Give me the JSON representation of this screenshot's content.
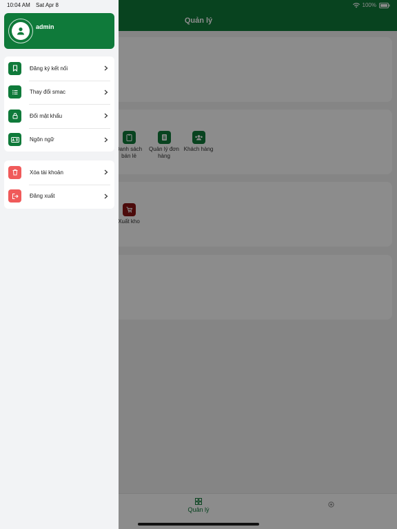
{
  "status_bar": {
    "time": "10:04 AM",
    "date": "Sat Apr 8",
    "battery": "100%"
  },
  "header": {
    "title": "Quản lý"
  },
  "tiles": {
    "retail_list": "Danh sách bán lẻ",
    "order_management": "Quản lý đơn hàng",
    "customers": "Khách hàng",
    "export_warehouse": "Xuất kho"
  },
  "tabbar": {
    "manage_label": "Quản lý"
  },
  "drawer": {
    "username": "admin",
    "menu": [
      {
        "label": "Đăng ký kết nối",
        "icon": "bookmark-icon"
      },
      {
        "label": "Thay đổi smac",
        "icon": "list-icon"
      },
      {
        "label": "Đổi mật khẩu",
        "icon": "lock-icon"
      },
      {
        "label": "Ngôn ngữ",
        "icon": "language-icon"
      }
    ],
    "account": [
      {
        "label": "Xóa tài khoản",
        "icon": "trash-icon"
      },
      {
        "label": "Đăng xuất",
        "icon": "logout-icon"
      }
    ]
  },
  "colors": {
    "primary": "#0f7a3a",
    "danger": "#f05a5a",
    "export": "#8a1414"
  }
}
